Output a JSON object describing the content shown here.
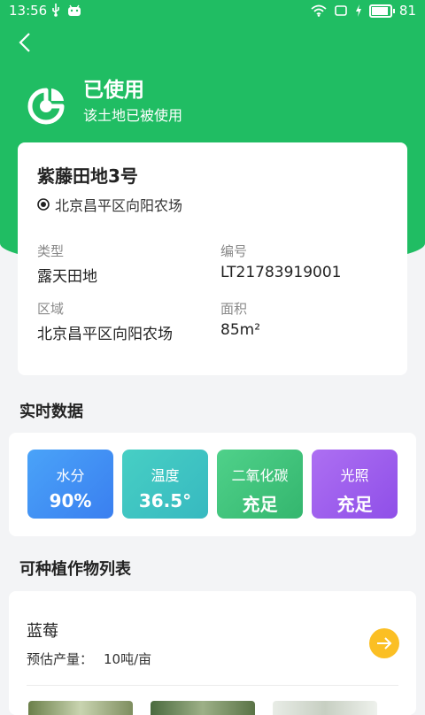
{
  "status_bar": {
    "time": "13:56",
    "battery": "81",
    "battery_level": 0.81
  },
  "header": {
    "back_icon": "chevron-left-icon",
    "status_title": "已使用",
    "status_subtitle": "该土地已被使用"
  },
  "field": {
    "name": "紫藤田地3号",
    "address": "北京昌平区向阳农场",
    "type_label": "类型",
    "type_value": "露天田地",
    "id_label": "编号",
    "id_value": "LT21783919001",
    "region_label": "区域",
    "region_value": "北京昌平区向阳农场",
    "area_label": "面积",
    "area_value": "85m²"
  },
  "realtime": {
    "title": "实时数据",
    "tiles": [
      {
        "label": "水分",
        "value": "90%"
      },
      {
        "label": "温度",
        "value": "36.5°"
      },
      {
        "label": "二氧化碳",
        "value": "充足"
      },
      {
        "label": "光照",
        "value": "充足"
      }
    ]
  },
  "crops": {
    "title": "可种植作物列表",
    "items": [
      {
        "name": "蓝莓",
        "yield_label": "预估产量：",
        "yield_value": "10吨/亩"
      }
    ]
  },
  "colors": {
    "brand_green": "#20bd63",
    "tile_water": "#3b8ff5",
    "tile_temp": "#3cc5c0",
    "tile_co2": "#3ec77a",
    "tile_light": "#9f5ef0",
    "action": "#fbbf24"
  }
}
